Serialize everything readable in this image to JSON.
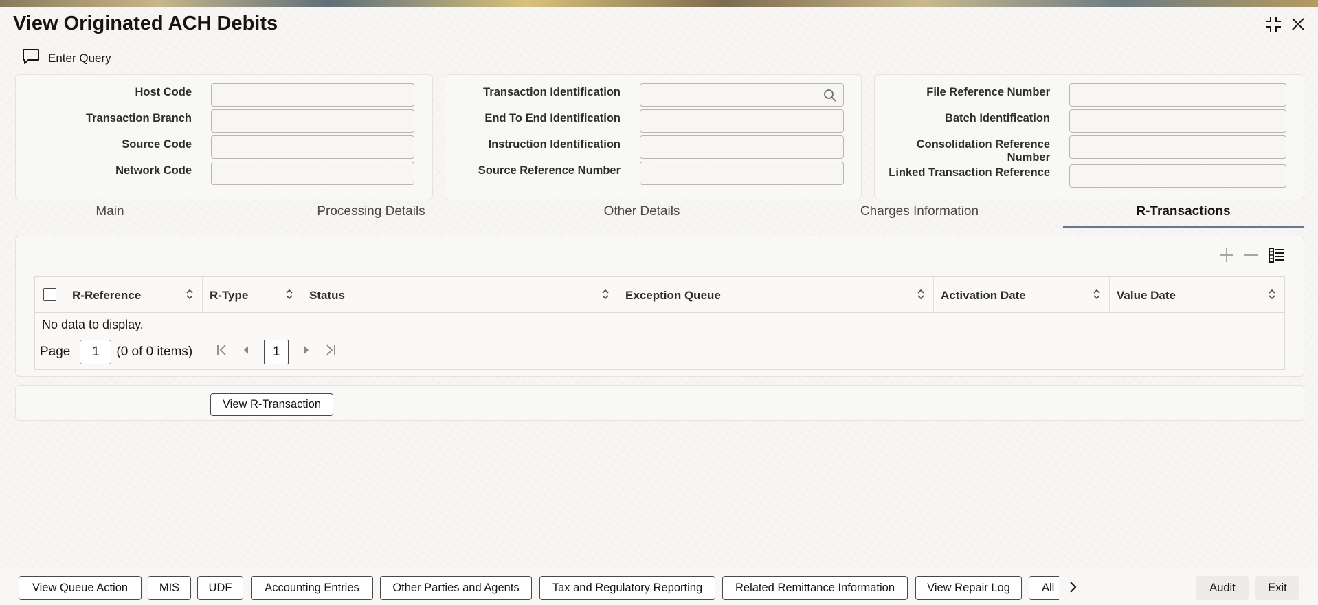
{
  "window": {
    "title": "View Originated ACH Debits",
    "icons": [
      "compress-icon",
      "close-icon"
    ]
  },
  "toolbar": {
    "enter_query": "Enter Query"
  },
  "panel1": {
    "fields": [
      {
        "label": "Host Code",
        "value": ""
      },
      {
        "label": "Transaction Branch",
        "value": ""
      },
      {
        "label": "Source Code",
        "value": ""
      },
      {
        "label": "Network Code",
        "value": ""
      }
    ]
  },
  "panel2": {
    "fields": [
      {
        "label": "Transaction Identification",
        "value": ""
      },
      {
        "label": "End To End Identification",
        "value": ""
      },
      {
        "label": "Instruction Identification",
        "value": ""
      },
      {
        "label": "Source Reference Number",
        "value": ""
      }
    ]
  },
  "panel3": {
    "fields": [
      {
        "label": "File Reference Number",
        "value": ""
      },
      {
        "label": "Batch Identification",
        "value": ""
      },
      {
        "label": "Consolidation Reference Number",
        "value": ""
      },
      {
        "label": "Linked Transaction Reference",
        "value": ""
      }
    ]
  },
  "tabs": [
    {
      "label": "Main",
      "active": false
    },
    {
      "label": "Processing Details",
      "active": false
    },
    {
      "label": "Other Details",
      "active": false
    },
    {
      "label": "Charges Information",
      "active": false
    },
    {
      "label": "R-Transactions",
      "active": true
    }
  ],
  "grid": {
    "columns": [
      "R-Reference",
      "R-Type",
      "Status",
      "Exception Queue",
      "Activation Date",
      "Value Date"
    ],
    "empty_text": "No data to display.",
    "pager": {
      "page_label": "Page",
      "page_value": "1",
      "count_text": "(0 of 0 items)",
      "current_page": "1"
    },
    "tool_icons": [
      "add-icon",
      "remove-icon",
      "column-list-icon"
    ]
  },
  "actions": {
    "view_r_transaction": "View R-Transaction"
  },
  "bottom_bar": {
    "buttons": [
      "View Queue Action",
      "MIS",
      "UDF",
      "Accounting Entries",
      "Other Parties and Agents",
      "Tax and Regulatory Reporting",
      "Related Remittance Information",
      "View Repair Log",
      "All"
    ],
    "audit": "Audit",
    "exit": "Exit"
  },
  "colors": {
    "tab_active_underline": "#6b7790",
    "text": "#161513"
  }
}
